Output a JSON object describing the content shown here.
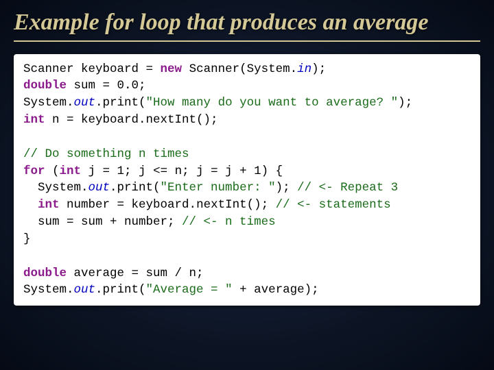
{
  "title": "Example for loop that produces an average",
  "code": {
    "l1_p1": "Scanner keyboard = ",
    "l1_kw": "new",
    "l1_p2": " Scanner(System.",
    "l1_it": "in",
    "l1_p3": ");",
    "l2_kw": "double",
    "l2_p1": " sum = 0.0;",
    "l3_p1": "System.",
    "l3_it": "out",
    "l3_p2": ".print(",
    "l3_str": "\"How many do you want to average? \"",
    "l3_p3": ");",
    "l4_kw": "int",
    "l4_p1": " n = keyboard.nextInt();",
    "l5_cmt": "// Do something n times",
    "l6_kw1": "for",
    "l6_p1": " (",
    "l6_kw2": "int",
    "l6_p2": " j = 1; j <= n; j = j + 1) {",
    "l7_ind": "  System.",
    "l7_it": "out",
    "l7_p2": ".print(",
    "l7_str": "\"Enter number: \"",
    "l7_p3": "); ",
    "l7_cmt": "// <- Repeat 3",
    "l8_ind": "  ",
    "l8_kw": "int",
    "l8_p1": " number = keyboard.nextInt(); ",
    "l8_cmt": "// <- statements",
    "l9_ind": "  sum = sum + number; ",
    "l9_cmt": "// <- n times",
    "l10": "}",
    "l11_kw": "double",
    "l11_p1": " average = sum / n;",
    "l12_p1": "System.",
    "l12_it": "out",
    "l12_p2": ".print(",
    "l12_str": "\"Average = \"",
    "l12_p3": " + average);"
  }
}
